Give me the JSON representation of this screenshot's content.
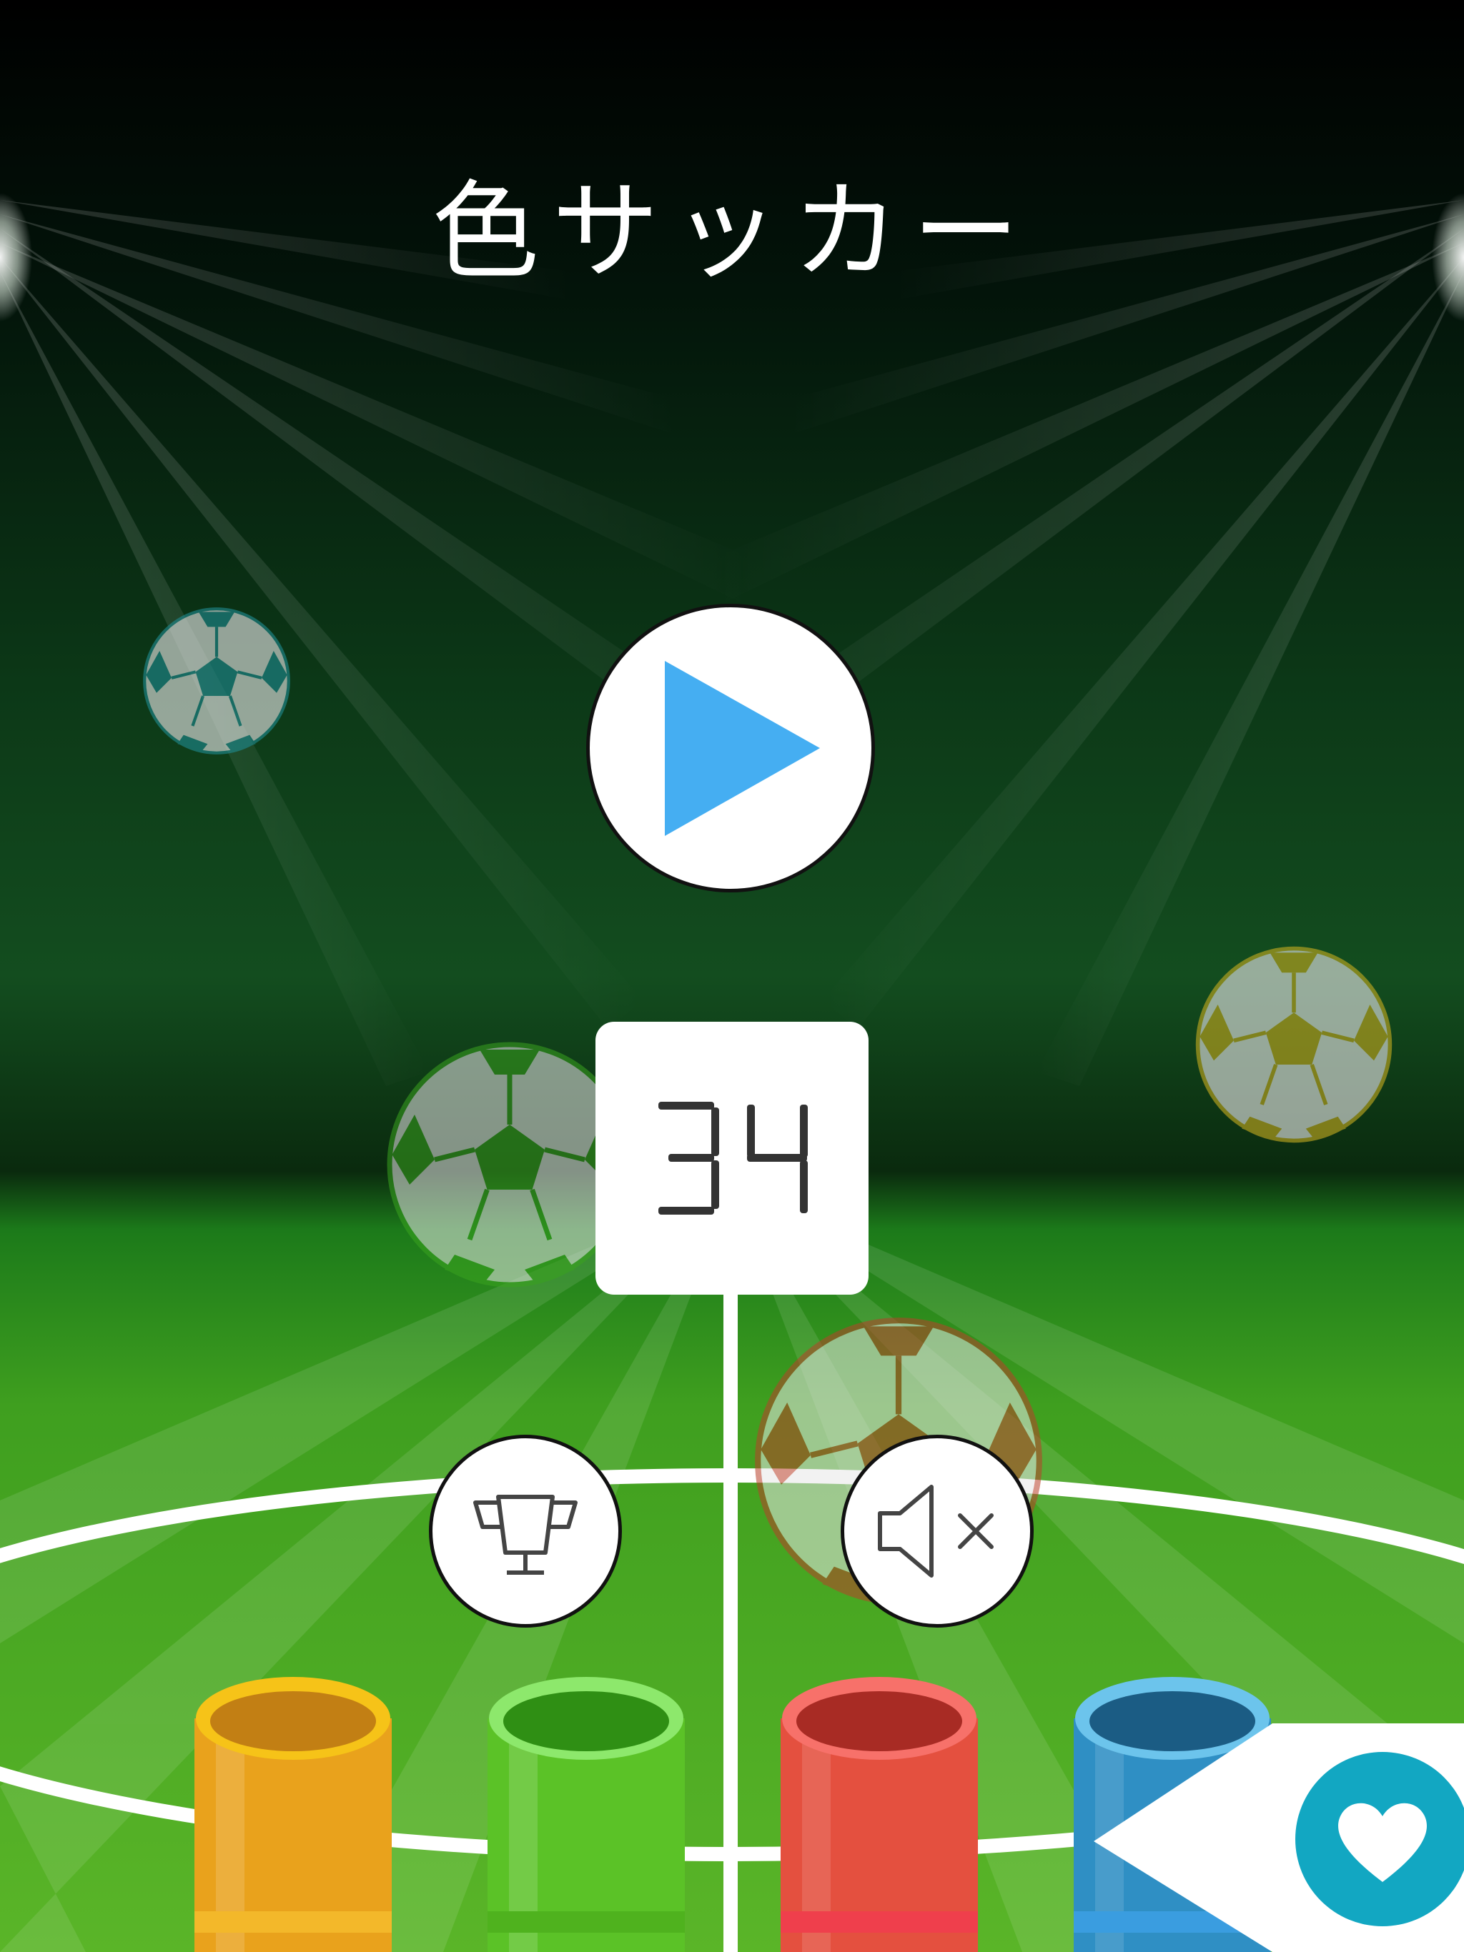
{
  "game": {
    "title": "色サッカー",
    "score": "34"
  },
  "buttons": {
    "play": "play-icon",
    "leaderboard": "trophy-icon",
    "sound": "mute-icon",
    "favorite": "heart-icon"
  },
  "colors": {
    "play_triangle": "#45aef2",
    "heart_circle": "#12a7c2",
    "tube_yellow": "#e9a21c",
    "tube_green": "#5bc227",
    "tube_red": "#e4503f",
    "tube_blue": "#2f8fc4",
    "ball_teal": "#1f8a90",
    "ball_green": "#3aa31f",
    "ball_yellow": "#c4aa20",
    "ball_red": "#b9402a"
  }
}
